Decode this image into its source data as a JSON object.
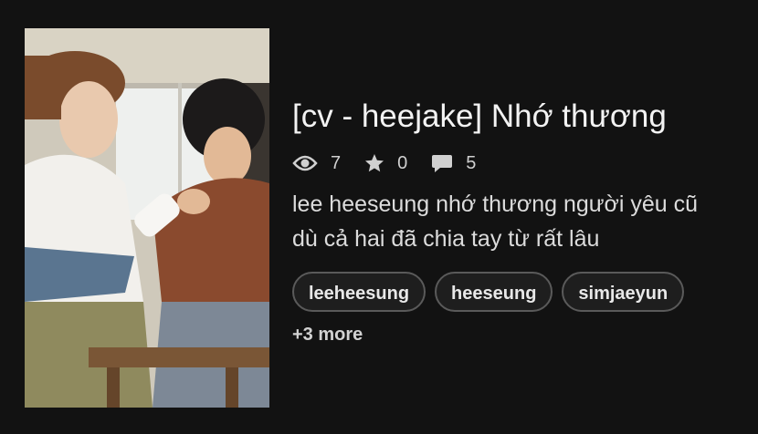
{
  "story": {
    "title": "[cv - heejake] Nhớ thương",
    "stats": {
      "views": "7",
      "votes": "0",
      "comments": "5"
    },
    "description": "lee heeseung nhớ thương người yêu cũ dù cả hai đã chia tay từ rất lâu",
    "tags": [
      "leeheesung",
      "heeseung",
      "simjaeyun"
    ],
    "more_tags": "+3 more"
  },
  "icons": {
    "views": "eye-icon",
    "votes": "star-icon",
    "comments": "comment-icon"
  },
  "colors": {
    "background": "#121212",
    "text": "#f3f3f3",
    "tag_border": "#5a5a5a"
  }
}
